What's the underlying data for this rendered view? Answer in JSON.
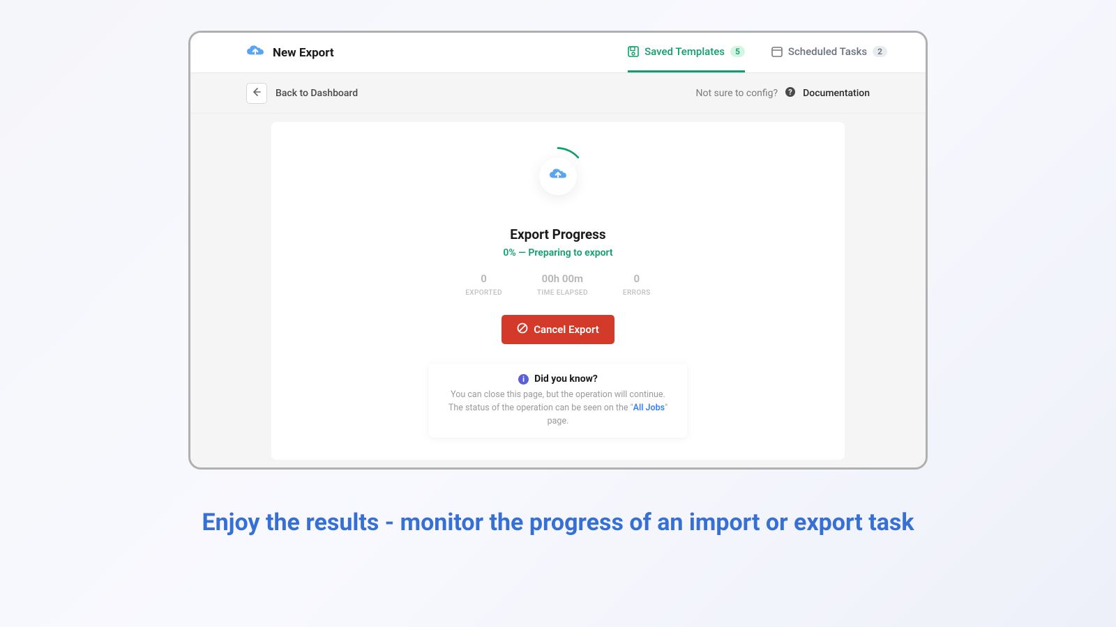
{
  "header": {
    "title": "New Export",
    "tabs": {
      "saved_templates": {
        "label": "Saved Templates",
        "count": "5"
      },
      "scheduled_tasks": {
        "label": "Scheduled Tasks",
        "count": "2"
      }
    }
  },
  "subheader": {
    "back_label": "Back to Dashboard",
    "hint": "Not sure to config?",
    "doc_label": "Documentation"
  },
  "progress": {
    "title": "Export Progress",
    "status": "0% — Preparing to export",
    "stats": {
      "exported": {
        "value": "0",
        "label": "EXPORTED"
      },
      "elapsed": {
        "value": "00h 00m",
        "label": "TIME ELAPSED"
      },
      "errors": {
        "value": "0",
        "label": "ERRORS"
      }
    },
    "cancel_label": "Cancel Export"
  },
  "tip": {
    "title": "Did you know?",
    "line1": "You can close this page, but the operation will continue.",
    "line2_pre": "The status of the operation can be seen on the \"",
    "line2_link": "All Jobs",
    "line2_post": "\" page."
  },
  "caption": "Enjoy the results - monitor the progress of an import or export task",
  "colors": {
    "accent_green": "#0e9f6e",
    "danger_red": "#d43a2a",
    "caption_blue": "#3670d6",
    "link_blue": "#3b82f6"
  }
}
